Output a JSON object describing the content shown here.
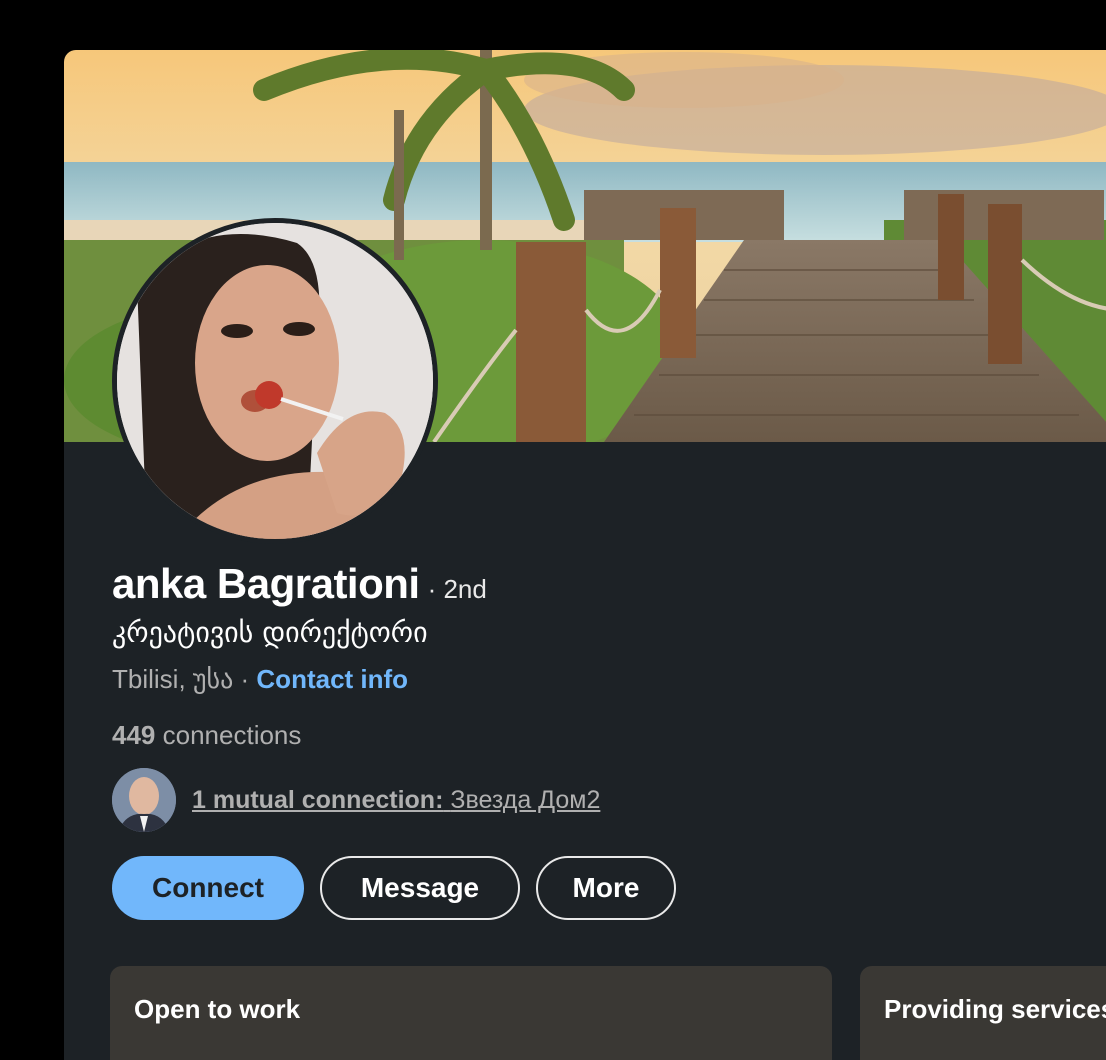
{
  "profile": {
    "name": "anka Bagrationi",
    "degree": "· 2nd",
    "headline": "კრეატივის დირექტორი",
    "location": "Tbilisi, უსა",
    "separator": "·",
    "contact_info_label": "Contact info",
    "connections_count": "449",
    "connections_label": "connections",
    "mutual_prefix": "1 mutual connection:",
    "mutual_name": "Звезда Дом2"
  },
  "actions": {
    "connect_label": "Connect",
    "message_label": "Message",
    "more_label": "More"
  },
  "panels": [
    {
      "title": "Open to work",
      "subtitle": ""
    },
    {
      "title": "Providing services",
      "subtitle": ""
    }
  ],
  "colors": {
    "background": "#000000",
    "card": "#1d2226",
    "accent": "#71b7fb",
    "panel": "#3a3834"
  }
}
